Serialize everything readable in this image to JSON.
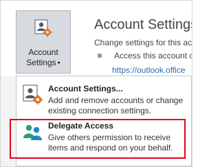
{
  "backstage": {
    "account_button": {
      "label_line1": "Account",
      "label_line2": "Settings",
      "caret": "▾"
    },
    "title": "Account Settings",
    "description": "Change settings for this ac",
    "bullet_text": "Access this account c",
    "link_text": "https://outlook.office"
  },
  "menu": {
    "items": [
      {
        "title": "Account Settings...",
        "description": "Add and remove accounts or change existing connection settings.",
        "icon": "account-settings-icon"
      },
      {
        "title": "Delegate Access",
        "description": "Give others permission to receive items and respond on your behalf.",
        "icon": "delegate-users-icon",
        "highlighted": true
      }
    ]
  },
  "colors": {
    "highlight_border": "#e3001b",
    "accent_blue": "#2b6cb0",
    "gear_orange": "#e8741e",
    "user_green": "#2e9e6a",
    "user_blue": "#1e88c8"
  }
}
